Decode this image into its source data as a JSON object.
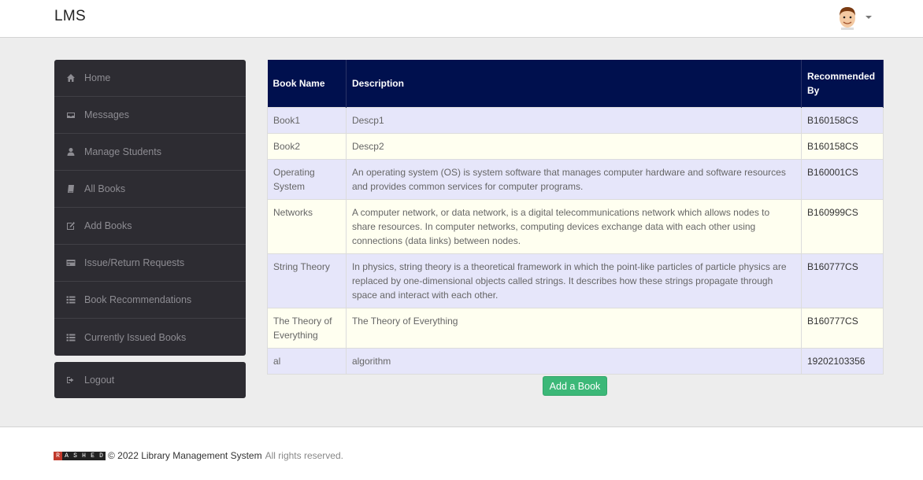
{
  "header": {
    "brand": "LMS"
  },
  "sidebar": {
    "items": [
      {
        "label": "Home",
        "icon": "home-icon"
      },
      {
        "label": "Messages",
        "icon": "inbox-icon"
      },
      {
        "label": "Manage Students",
        "icon": "user-icon"
      },
      {
        "label": "All Books",
        "icon": "book-icon"
      },
      {
        "label": "Add Books",
        "icon": "edit-icon"
      },
      {
        "label": "Issue/Return Requests",
        "icon": "credit-card-icon"
      },
      {
        "label": "Book Recommendations",
        "icon": "list-icon"
      },
      {
        "label": "Currently Issued Books",
        "icon": "list-icon"
      }
    ],
    "logout": "Logout"
  },
  "table": {
    "headers": [
      "Book Name",
      "Description",
      "Recommended By"
    ],
    "rows": [
      {
        "name": "Book1",
        "desc": "Descp1",
        "by": "B160158CS"
      },
      {
        "name": "Book2",
        "desc": "Descp2",
        "by": "B160158CS"
      },
      {
        "name": "Operating System",
        "desc": "An operating system (OS) is system software that manages computer hardware and software resources and provides common services for computer programs.",
        "by": "B160001CS"
      },
      {
        "name": "Networks",
        "desc": "A computer network, or data network, is a digital telecommunications network which allows nodes to share resources. In computer networks, computing devices exchange data with each other using connections (data links) between nodes.",
        "by": "B160999CS"
      },
      {
        "name": "String Theory",
        "desc": "In physics, string theory is a theoretical framework in which the point-like particles of particle physics are replaced by one-dimensional objects called strings. It describes how these strings propagate through space and interact with each other.",
        "by": "B160777CS"
      },
      {
        "name": "The Theory of Everything",
        "desc": "The Theory of Everything",
        "by": "B160777CS"
      },
      {
        "name": "al",
        "desc": "algorithm",
        "by": "19202103356"
      }
    ]
  },
  "add_button": "Add a Book",
  "footer": {
    "logo_letters": [
      "R",
      "A",
      "S",
      "H",
      "E",
      "D"
    ],
    "copyright": "© 2022 Library Management System",
    "rights": "All rights reserved."
  },
  "colors": {
    "header_bg": "#00104e",
    "row_odd": "#e6e6fa",
    "row_even": "#fffff0",
    "sidebar_bg": "#2d2c32",
    "button": "#3cb878"
  }
}
